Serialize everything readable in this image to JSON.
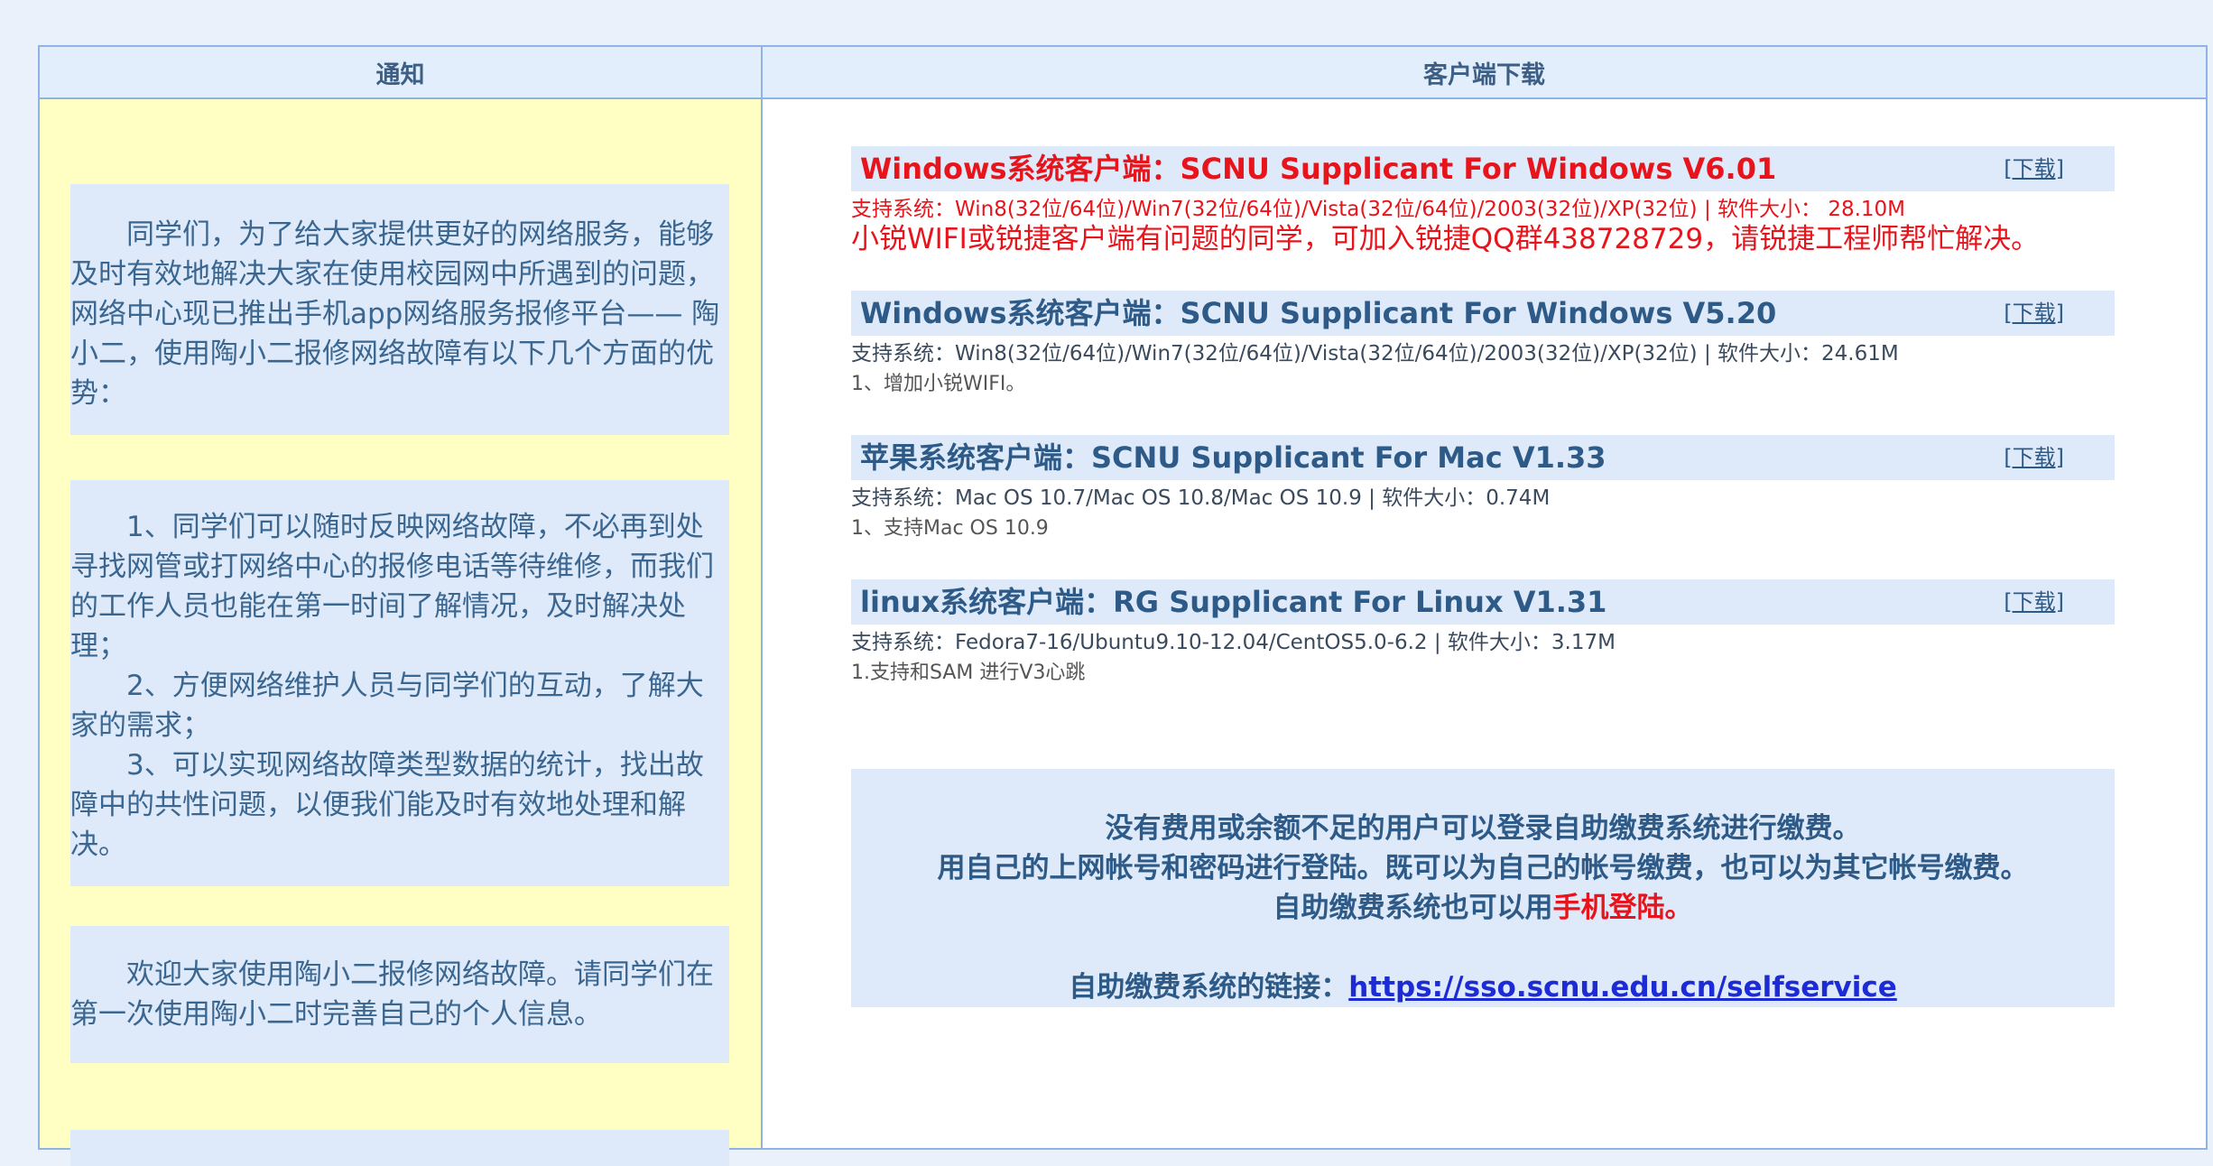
{
  "header": {
    "notice_title": "通知",
    "client_title": "客户端下载"
  },
  "notices": [
    {
      "paragraphs": [
        "同学们，为了给大家提供更好的网络服务，能够及时有效地解决大家在使用校园网中所遇到的问题，网络中心现已推出手机app网络服务报修平台—— 陶小二，使用陶小二报修网络故障有以下几个方面的优势："
      ]
    },
    {
      "paragraphs": [
        "1、同学们可以随时反映网络故障，不必再到处寻找网管或打网络中心的报修电话等待维修，而我们的工作人员也能在第一时间了解情况，及时解决处理；",
        "2、方便网络维护人员与同学们的互动，了解大家的需求；",
        "3、可以实现网络故障类型数据的统计，找出故障中的共性问题，以便我们能及时有效地处理和解决。"
      ]
    },
    {
      "paragraphs": [
        "欢迎大家使用陶小二报修网络故障。请同学们在第一次使用陶小二时完善自己的个人信息。"
      ]
    }
  ],
  "downloads": [
    {
      "title": "Windows系统客户端：SCNU Supplicant For Windows V6.01",
      "link": "[下载]",
      "system": "支持系统：Win8(32位/64位)/Win7(32位/64位)/Vista(32位/64位)/2003(32位)/XP(32位) | 软件大小： 28.10M",
      "highlight": true
    },
    {
      "title": "Windows系统客户端：SCNU Supplicant For Windows V5.20",
      "link": "[下载]",
      "system": "支持系统：Win8(32位/64位)/Win7(32位/64位)/Vista(32位/64位)/2003(32位)/XP(32位) | 软件大小：24.61M",
      "note": "1、增加小锐WIFI。"
    },
    {
      "title": "苹果系统客户端：SCNU Supplicant For Mac V1.33",
      "link": "[下载]",
      "system": "支持系统：Mac OS 10.7/Mac OS 10.8/Mac OS 10.9 | 软件大小：0.74M",
      "note": "1、支持Mac OS 10.9"
    },
    {
      "title": "linux系统客户端：RG Supplicant For Linux V1.31",
      "link": "[下载]",
      "system": "支持系统：Fedora7-16/Ubuntu9.10-12.04/CentOS5.0-6.2 | 软件大小：3.17M",
      "note": "1.支持和SAM 进行V3心跳"
    }
  ],
  "warning": "小锐WIFI或锐捷客户端有问题的同学，可加入锐捷QQ群438728729，请锐捷工程师帮忙解决。",
  "payment": {
    "line1": "没有费用或余额不足的用户可以登录自助缴费系统进行缴费。",
    "line2": "用自己的上网帐号和密码进行登陆。既可以为自己的帐号缴费，也可以为其它帐号缴费。",
    "line3_prefix": "自助缴费系统也可以用",
    "line3_highlight": "手机登陆。",
    "link_label": "自助缴费系统的链接：",
    "link_url": "https://sso.scnu.edu.cn/selfservice"
  },
  "colors": {
    "background": "#eaf1fa",
    "border": "#8fb4e3",
    "panel": "#deeafa",
    "notice_bg": "#ffffc4",
    "accent_red": "#e8141b",
    "link_blue": "#1d2bd6"
  }
}
